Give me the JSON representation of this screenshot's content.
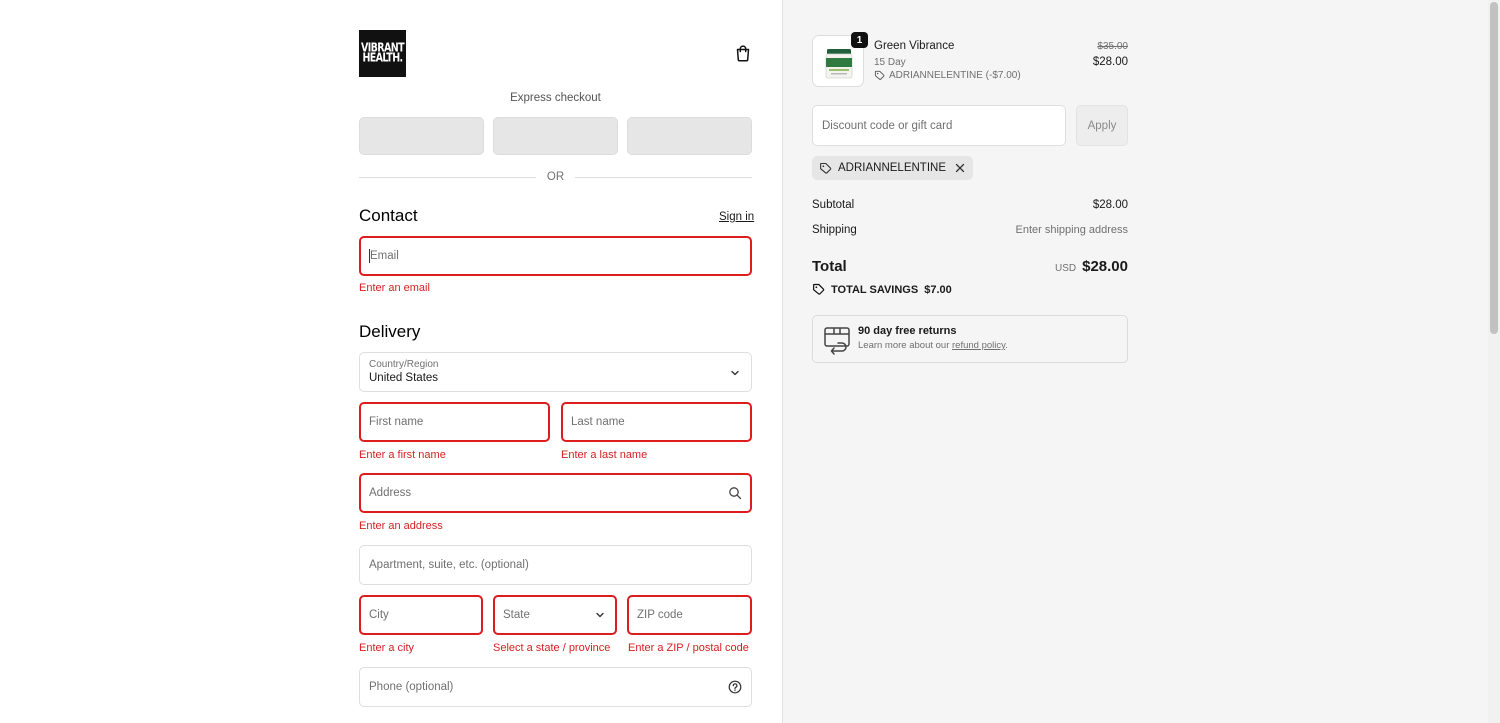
{
  "brand": {
    "logo_line1": "VIBRANT",
    "logo_line2": "HEALTH."
  },
  "express": {
    "label": "Express checkout",
    "or_text": "OR"
  },
  "contact": {
    "title": "Contact",
    "sign_in": "Sign in",
    "email_placeholder": "Email",
    "email_error": "Enter an email"
  },
  "delivery": {
    "title": "Delivery",
    "country_label": "Country/Region",
    "country_value": "United States",
    "first_name_placeholder": "First name",
    "first_name_error": "Enter a first name",
    "last_name_placeholder": "Last name",
    "last_name_error": "Enter a last name",
    "address_placeholder": "Address",
    "address_error": "Enter an address",
    "apartment_placeholder": "Apartment, suite, etc. (optional)",
    "city_placeholder": "City",
    "city_error": "Enter a city",
    "state_placeholder": "State",
    "state_error": "Select a state / province",
    "zip_placeholder": "ZIP code",
    "zip_error": "Enter a ZIP / postal code",
    "phone_placeholder": "Phone (optional)"
  },
  "cart": {
    "quantity": "1",
    "product_name": "Green Vibrance",
    "variant": "15 Day",
    "discount_line": "ADRIANNELENTINE (-$7.00)",
    "original_price": "$35.00",
    "price": "$28.00"
  },
  "discount": {
    "placeholder": "Discount code or gift card",
    "apply_label": "Apply",
    "applied_code": "ADRIANNELENTINE"
  },
  "summary": {
    "subtotal_label": "Subtotal",
    "subtotal_value": "$28.00",
    "shipping_label": "Shipping",
    "shipping_value": "Enter shipping address",
    "total_label": "Total",
    "currency": "USD",
    "total_value": "$28.00",
    "savings_label": "TOTAL SAVINGS",
    "savings_value": "$7.00"
  },
  "returns": {
    "title": "90 day free returns",
    "text": "Learn more about our ",
    "link": "refund policy",
    "suffix": "."
  },
  "colors": {
    "error": "#dd1d1d",
    "panel": "#f5f5f5"
  }
}
